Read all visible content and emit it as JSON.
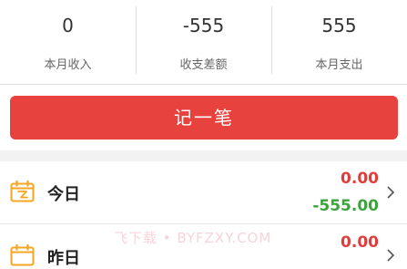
{
  "summary": {
    "income": {
      "value": "0",
      "label": "本月收入"
    },
    "balance": {
      "value": "-555",
      "label": "收支差额"
    },
    "expense": {
      "value": "555",
      "label": "本月支出"
    }
  },
  "record_button": {
    "label": "记一笔"
  },
  "days": [
    {
      "label": "今日",
      "income": "0.00",
      "expense": "-555.00",
      "icon": "calendar-icon"
    },
    {
      "label": "昨日",
      "income": "0.00",
      "icon": "calendar-icon"
    }
  ],
  "watermark": "飞下载 • BYFZXY.COM",
  "colors": {
    "accent": "#e8423e",
    "income": "#e03c3c",
    "expense": "#3aa33a",
    "icon": "#f5a623"
  }
}
